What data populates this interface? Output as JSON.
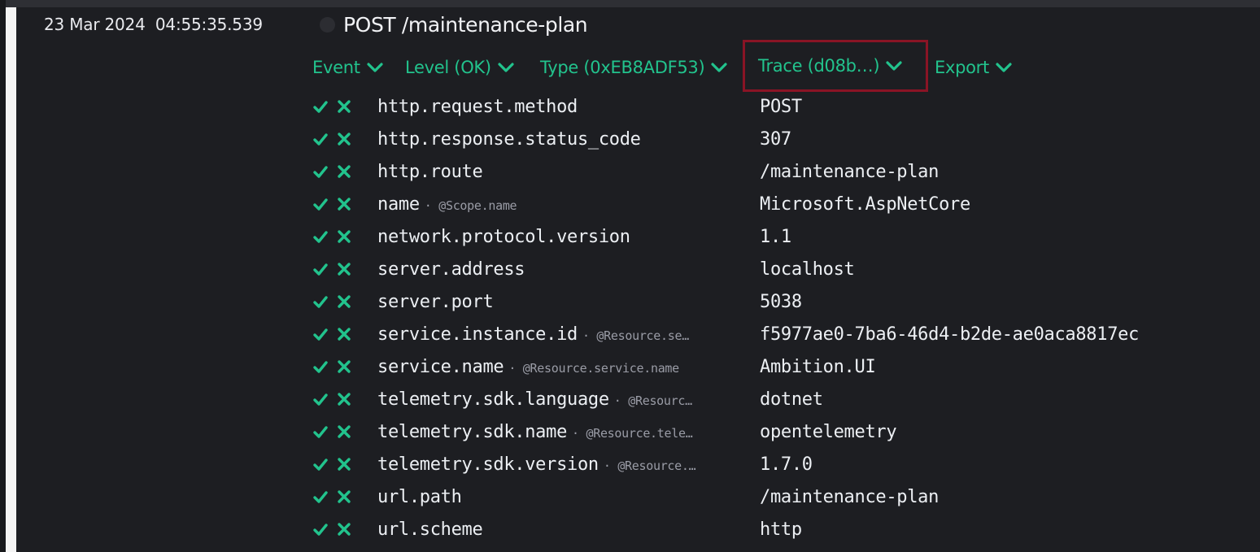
{
  "event": {
    "timestamp": "23 Mar 2024  04:55:35.539",
    "title": "POST /maintenance-plan"
  },
  "menu": [
    {
      "label": "Event"
    },
    {
      "label": "Level (OK)"
    },
    {
      "label": "Type (0xEB8ADF53)"
    },
    {
      "label": "Trace (d08b…)"
    },
    {
      "label": "Export"
    }
  ],
  "properties": [
    {
      "key": "http.request.method",
      "scope": "",
      "value": "POST"
    },
    {
      "key": "http.response.status_code",
      "scope": "",
      "value": "307"
    },
    {
      "key": "http.route",
      "scope": "",
      "value": "/maintenance-plan"
    },
    {
      "key": "name",
      "scope": "· @Scope.name",
      "value": "Microsoft.AspNetCore"
    },
    {
      "key": "network.protocol.version",
      "scope": "",
      "value": "1.1"
    },
    {
      "key": "server.address",
      "scope": "",
      "value": "localhost"
    },
    {
      "key": "server.port",
      "scope": "",
      "value": "5038"
    },
    {
      "key": "service.instance.id",
      "scope": "· @Resource.se…",
      "value": "f5977ae0-7ba6-46d4-b2de-ae0aca8817ec"
    },
    {
      "key": "service.name",
      "scope": "· @Resource.service.name",
      "value": "Ambition.UI"
    },
    {
      "key": "telemetry.sdk.language",
      "scope": "· @Resourc…",
      "value": "dotnet"
    },
    {
      "key": "telemetry.sdk.name",
      "scope": "· @Resource.tele…",
      "value": "opentelemetry"
    },
    {
      "key": "telemetry.sdk.version",
      "scope": "· @Resource.…",
      "value": "1.7.0"
    },
    {
      "key": "url.path",
      "scope": "",
      "value": "/maintenance-plan"
    },
    {
      "key": "url.scheme",
      "scope": "",
      "value": "http"
    }
  ],
  "colors": {
    "accent": "#22c38d",
    "highlight": "#8a1425",
    "background": "#1d1e22"
  },
  "icons": {
    "include": "check-icon",
    "exclude": "cross-icon",
    "menu_expand": "chevron-down-icon"
  }
}
